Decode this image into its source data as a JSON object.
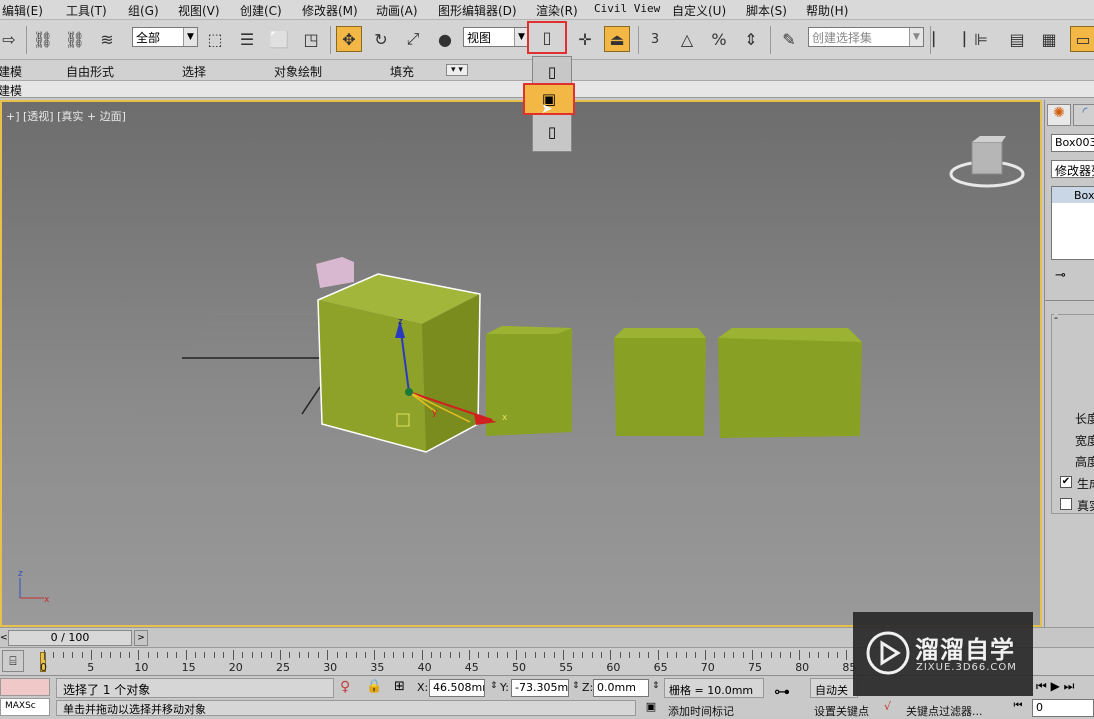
{
  "menu": [
    "编辑(E)",
    "工具(T)",
    "组(G)",
    "视图(V)",
    "创建(C)",
    "修改器(M)",
    "动画(A)",
    "图形编辑器(D)",
    "渲染(R)",
    "Civil View",
    "自定义(U)",
    "脚本(S)",
    "帮助(H)"
  ],
  "toolbar": {
    "filter_value": "全部",
    "refcoord_value": "视图",
    "named_selection_placeholder": "创建选择集",
    "snap_3": "3",
    "snap_angle": "△",
    "snap_percent": "%"
  },
  "ribbon": {
    "tabs": [
      "建模",
      "自由形式",
      "选择",
      "对象绘制",
      "填充"
    ],
    "sub_label": "建模"
  },
  "viewport": {
    "label": "+] [透视] [真实 + 边面]",
    "axis_x": "x",
    "axis_y": "y",
    "axis_z": "z"
  },
  "command_panel": {
    "object_name": "Box003",
    "modifier_list": "修改器列",
    "stack_item": "Box",
    "param_length": "长度",
    "param_width": "宽度",
    "param_height": "高度",
    "check_generate": "生成",
    "check_realworld": "真实"
  },
  "time_slider": {
    "frame": "0 / 100"
  },
  "trackbar": {
    "ticks": [
      "0",
      "5",
      "10",
      "15",
      "20",
      "25",
      "30",
      "35",
      "40",
      "45",
      "50",
      "55",
      "60",
      "65",
      "70",
      "75",
      "80",
      "85"
    ]
  },
  "status": {
    "maxscript": "MAXSc",
    "selection_text": "选择了 1 个对象",
    "prompt_text": "单击并拖动以选择并移动对象",
    "x_label": "X:",
    "x_value": "46.508mm",
    "y_label": "Y:",
    "y_value": "-73.305mm",
    "z_label": "Z:",
    "z_value": "0.0mm",
    "grid_text": "栅格 = 10.0mm",
    "add_time_tag": "添加时间标记",
    "auto_key": "自动关",
    "set_key": "设置关键点",
    "key_filters": "关键点过滤器...",
    "frame_field": "0"
  },
  "watermark": {
    "brand": "溜溜自学",
    "url": "ZIXUE.3D66.COM"
  },
  "colors": {
    "box_green": "#8ea22a",
    "accent_yellow": "#f2b744",
    "viewport_border": "#e6c24a",
    "highlight_red": "#e03030"
  }
}
